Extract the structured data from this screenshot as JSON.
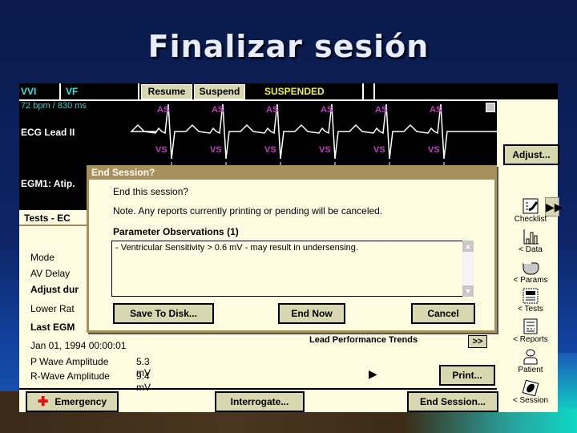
{
  "slide": {
    "title": "Finalizar sesión"
  },
  "topbar": {
    "mode": "VVI",
    "rhythm": "VF",
    "resume_label": "Resume",
    "suspend_label": "Suspend",
    "status": "SUSPENDED"
  },
  "ecg": {
    "rate": "72 bpm / 830 ms",
    "lead_label": "ECG Lead II",
    "egm_label": "EGM1: Atip.",
    "markers": {
      "atrial": "AS",
      "ventricular": "VS"
    },
    "adjust_label": "Adjust..."
  },
  "tests": {
    "header": "Tests - EC",
    "labels": [
      "Mode",
      "AV Delay",
      "Adjust dur",
      "Lower Rat",
      "Last EGM"
    ],
    "timestamp": "Jan 01, 1994 00:00:01",
    "p_wave_label": "P Wave Amplitude",
    "p_wave_value": "5.3 mV",
    "r_wave_label": "R-Wave Amplitude",
    "r_wave_value": "9.4 mV",
    "lead_trends_label": "Lead Performance Trends",
    "lead_trends_button": ">>",
    "print_label": "Print..."
  },
  "bottom": {
    "emergency_label": "Emergency",
    "interrogate_label": "Interrogate...",
    "end_session_label": "End Session..."
  },
  "side_nav": [
    {
      "label": "Checklist",
      "icon": "checklist-icon"
    },
    {
      "label": "< Data",
      "icon": "bar-chart-icon"
    },
    {
      "label": "< Params",
      "icon": "params-icon"
    },
    {
      "label": "< Tests",
      "icon": "tests-icon"
    },
    {
      "label": "< Reports",
      "icon": "reports-icon"
    },
    {
      "label": "Patient",
      "icon": "patient-icon"
    },
    {
      "label": "< Session",
      "icon": "session-icon"
    }
  ],
  "dialog": {
    "title": "End Session?",
    "question": "End this session?",
    "note": "Note. Any reports currently printing or pending will be canceled.",
    "observations_header": "Parameter Observations (1)",
    "observations": [
      "- Ventricular Sensitivity > 0.6 mV - may result in undersensing."
    ],
    "save_label": "Save To Disk...",
    "end_now_label": "End Now",
    "cancel_label": "Cancel"
  },
  "colors": {
    "accent_cyan": "#40e0e0",
    "status_yellow": "#f0f040",
    "marker_magenta": "#c040c0",
    "emergency_red": "#e01010",
    "dialog_title_bg": "#a8905c",
    "panel_bg": "#fdfbe0",
    "button_bg": "#d8d8b0"
  }
}
